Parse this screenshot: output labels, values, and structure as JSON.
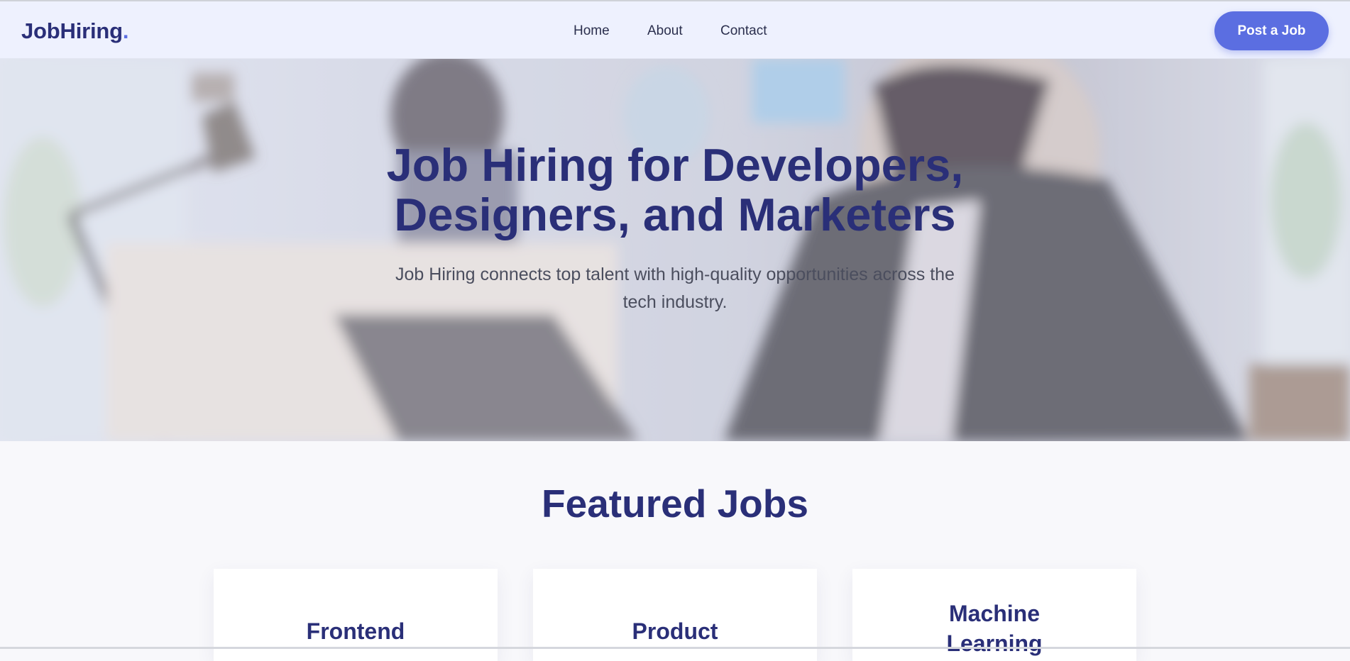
{
  "brand": {
    "name": "JobHiring",
    "dot": ".",
    "accent": "#5b6ee1",
    "primary": "#2a2f78"
  },
  "nav": {
    "links": [
      {
        "label": "Home"
      },
      {
        "label": "About"
      },
      {
        "label": "Contact"
      }
    ],
    "cta_label": "Post a Job"
  },
  "hero": {
    "title_line1": "Job Hiring for Developers,",
    "title_line2": "Designers, and Marketers",
    "subtitle_line1": "Job Hiring connects top talent with high-quality opportunities across the",
    "subtitle_line2": "tech industry."
  },
  "featured": {
    "title": "Featured Jobs",
    "cards": [
      {
        "title": "Frontend"
      },
      {
        "title": "Product"
      },
      {
        "title": "Machine Learning"
      }
    ]
  }
}
